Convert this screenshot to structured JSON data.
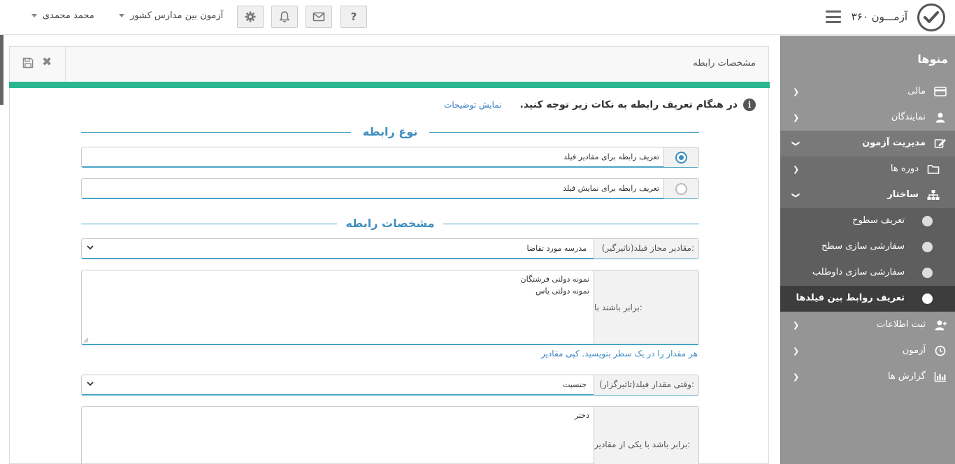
{
  "header": {
    "app_title": "آزمـــون ۳۶۰",
    "help_label": "?",
    "school_menu": "آزمون بین مدارس کشور",
    "user_menu": "محمد محمدی"
  },
  "sidebar": {
    "title": "منوها",
    "items": [
      {
        "label": "مالی",
        "icon": "credit-card-icon"
      },
      {
        "label": "نمایندگان",
        "icon": "agent-icon"
      },
      {
        "label": "مدیریت آزمون",
        "icon": "edit-icon"
      },
      {
        "label": "دوره ها",
        "icon": "folder-icon"
      },
      {
        "label": "ساختار",
        "icon": "sitemap-icon"
      },
      {
        "label": "تعریف سطوح"
      },
      {
        "label": "سفارشی سازی سطح"
      },
      {
        "label": "سفارشی سازی داوطلب"
      },
      {
        "label": "تعریف روابط بین فیلدها"
      },
      {
        "label": "ثبت اطلاعات",
        "icon": "user-plus-icon"
      },
      {
        "label": "آزمون",
        "icon": "clock-icon"
      },
      {
        "label": "گزارش ها",
        "icon": "bar-chart-icon"
      }
    ]
  },
  "panel": {
    "title": "مشخصات رابطه",
    "notice_text": "در هنگام تعریف رابطه به نکات زیر توجه کنید.",
    "notice_link": "نمایش توضیحات",
    "section_type": "نوع رابطه",
    "radio_options": [
      {
        "label": "تعریف رابطه برای مقادیر فیلد",
        "selected": true
      },
      {
        "label": "تعریف رابطه برای نمایش فیلد",
        "selected": false
      }
    ],
    "section_spec": "مشخصات رابطه",
    "field1": {
      "label": "مقادیر مجاز فیلد(تاثیرگیر):",
      "value": "مدرسه مورد تقاضا"
    },
    "area1": {
      "label": "برابر باشند با:",
      "line1": "نمونه دولتی فرشتگان",
      "line2": "نمونه دولتی یاس"
    },
    "help_text": "هر مقدار را در یک سطر بنویسید.",
    "help_link": "کپی مقادیر",
    "field2": {
      "label": "وقتی مقدار فیلد(تاثیرگزار):",
      "value": "جنسیت"
    },
    "area2": {
      "label": "برابر باشد با یکی از مقادیر:",
      "line1": "دختر"
    }
  },
  "colors": {
    "accent_green": "#2bb68e",
    "accent_blue": "#3f8fbf",
    "sidebar_bg": "#959595"
  }
}
